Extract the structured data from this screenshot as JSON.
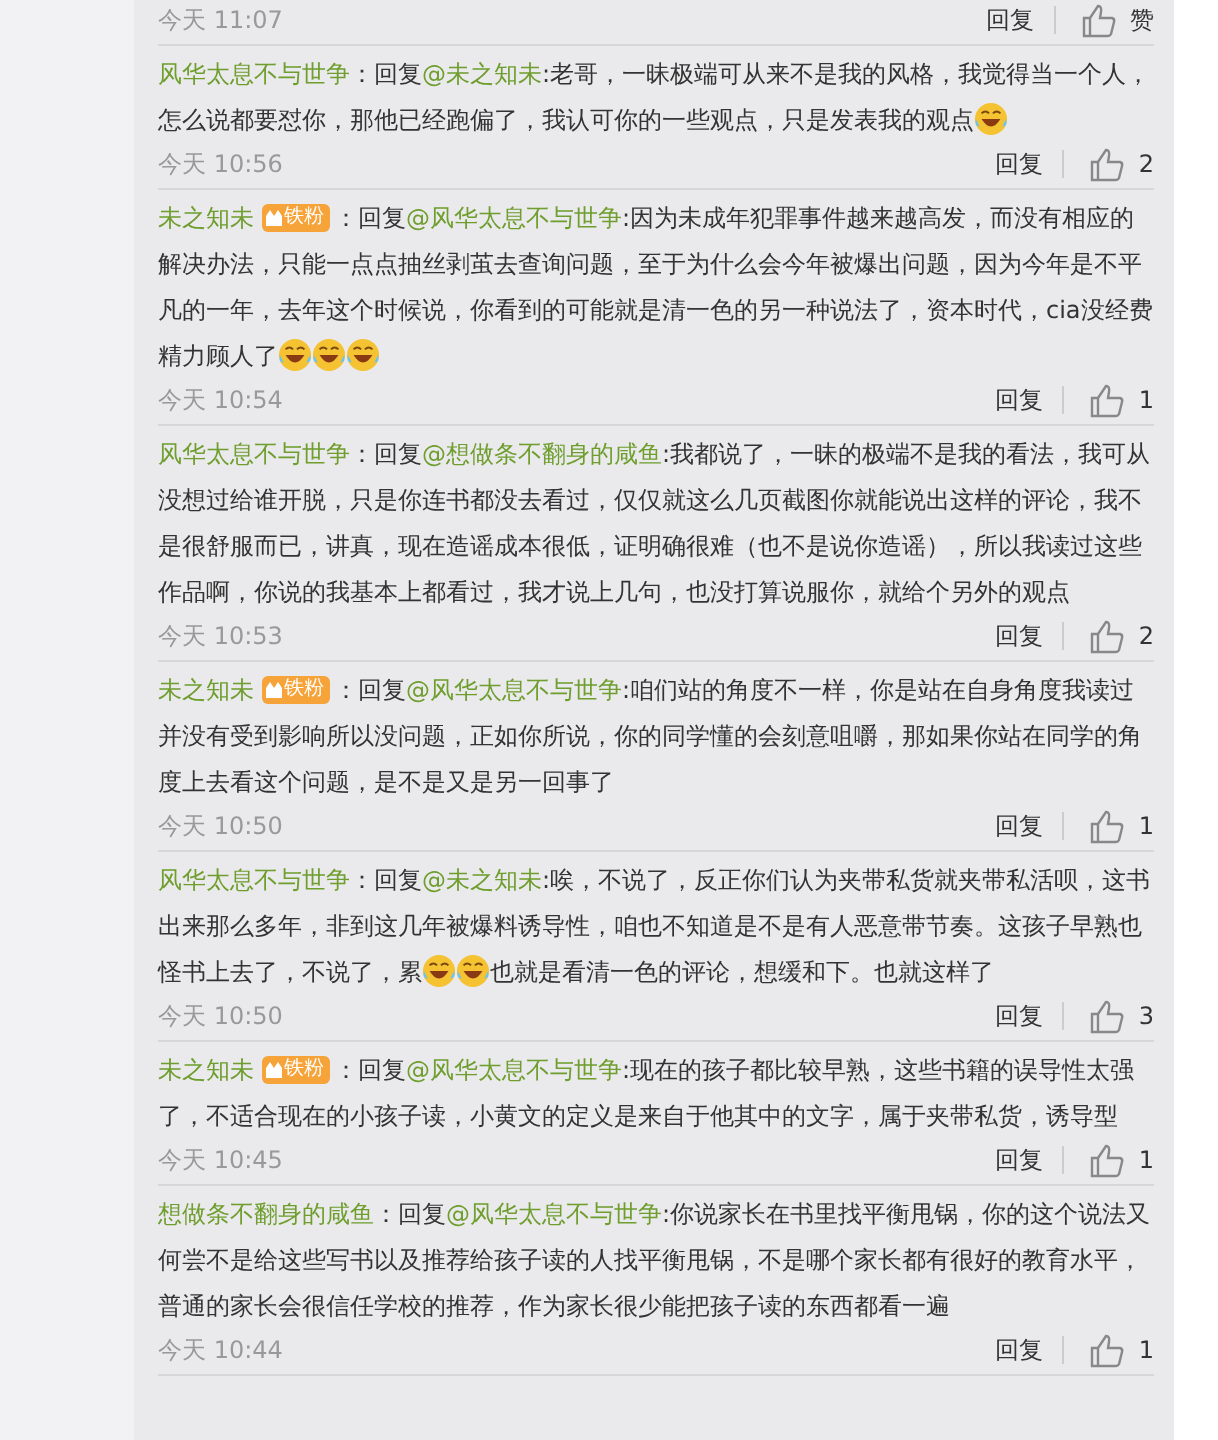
{
  "comments": [
    {
      "time": "今天 11:07",
      "reply": "回复",
      "likes": "赞"
    },
    {
      "author": "风华太息不与世争",
      "reply_label": "：回复",
      "mention": "@未之知未",
      "body": [
        {
          "kind": "text",
          "text": ":老哥，一昧极端可从来不是我的风格，我觉得当一个人，怎么说都要怼你，那他已经跑偏了，我认可你的一些观点，只是发表我的观点"
        },
        {
          "kind": "emoji"
        }
      ],
      "time": "今天 10:56",
      "reply": "回复",
      "likes": "2"
    },
    {
      "author": "未之知未",
      "badge": "铁粉",
      "reply_label": "：回复",
      "mention": "@风华太息不与世争",
      "body": [
        {
          "kind": "text",
          "text": ":因为未成年犯罪事件越来越高发，而没有相应的解决办法，只能一点点抽丝剥茧去查询问题，至于为什么会今年被爆出问题，因为今年是不平凡的一年，去年这个时候说，你看到的可能就是清一色的另一种说法了，资本时代，cia没经费精力顾人了"
        },
        {
          "kind": "emoji"
        },
        {
          "kind": "emoji"
        },
        {
          "kind": "emoji"
        }
      ],
      "time": "今天 10:54",
      "reply": "回复",
      "likes": "1"
    },
    {
      "author": "风华太息不与世争",
      "reply_label": "：回复",
      "mention": "@想做条不翻身的咸鱼",
      "body": [
        {
          "kind": "text",
          "text": ":我都说了，一昧的极端不是我的看法，我可从没想过给谁开脱，只是你连书都没去看过，仅仅就这么几页截图你就能说出这样的评论，我不是很舒服而已，讲真，现在造谣成本很低，证明确很难（也不是说你造谣），所以我读过这些作品啊，你说的我基本上都看过，我才说上几句，也没打算说服你，就给个另外的观点"
        }
      ],
      "time": "今天 10:53",
      "reply": "回复",
      "likes": "2"
    },
    {
      "author": "未之知未",
      "badge": "铁粉",
      "reply_label": "：回复",
      "mention": "@风华太息不与世争",
      "body": [
        {
          "kind": "text",
          "text": ":咱们站的角度不一样，你是站在自身角度我读过并没有受到影响所以没问题，正如你所说，你的同学懂的会刻意咀嚼，那如果你站在同学的角度上去看这个问题，是不是又是另一回事了"
        }
      ],
      "time": "今天 10:50",
      "reply": "回复",
      "likes": "1"
    },
    {
      "author": "风华太息不与世争",
      "reply_label": "：回复",
      "mention": "@未之知未",
      "body": [
        {
          "kind": "text",
          "text": ":唉，不说了，反正你们认为夹带私货就夹带私活呗，这书出来那么多年，非到这几年被爆料诱导性，咱也不知道是不是有人恶意带节奏。这孩子早熟也怪书上去了，不说了，累"
        },
        {
          "kind": "emoji"
        },
        {
          "kind": "emoji"
        },
        {
          "kind": "text",
          "text": "也就是看清一色的评论，想缓和下。也就这样了"
        }
      ],
      "time": "今天 10:50",
      "reply": "回复",
      "likes": "3"
    },
    {
      "author": "未之知未",
      "badge": "铁粉",
      "reply_label": "：回复",
      "mention": "@风华太息不与世争",
      "body": [
        {
          "kind": "text",
          "text": ":现在的孩子都比较早熟，这些书籍的误导性太强了，不适合现在的小孩子读，小黄文的定义是来自于他其中的文字，属于夹带私货，诱导型"
        }
      ],
      "time": "今天 10:45",
      "reply": "回复",
      "likes": "1"
    },
    {
      "author": "想做条不翻身的咸鱼",
      "reply_label": "：回复",
      "mention": "@风华太息不与世争",
      "body": [
        {
          "kind": "text",
          "text": ":你说家长在书里找平衡甩锅，你的这个说法又何尝不是给这些写书以及推荐给孩子读的人找平衡甩锅，不是哪个家长都有很好的教育水平，普通的家长会很信任学校的推荐，作为家长很少能把孩子读的东西都看一遍"
        }
      ],
      "time": "今天 10:44",
      "reply": "回复",
      "likes": "1"
    }
  ]
}
